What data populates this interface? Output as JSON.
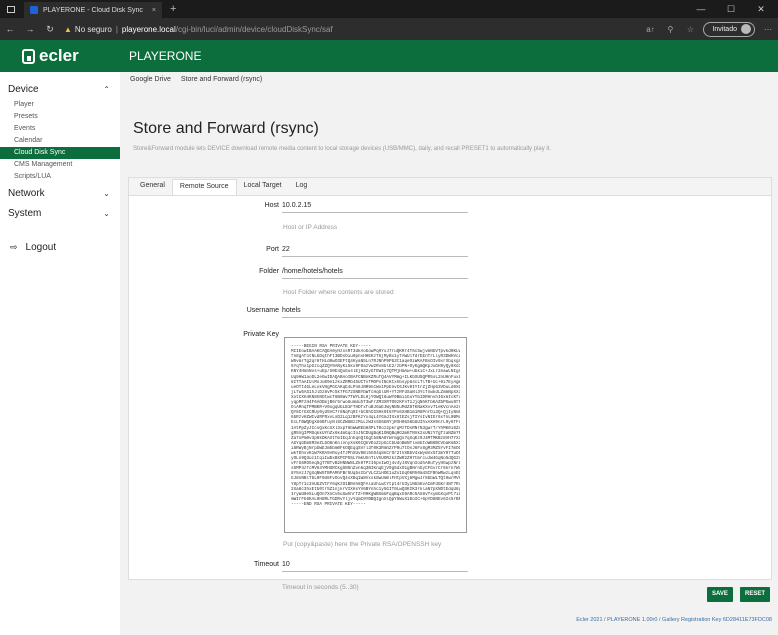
{
  "browser": {
    "tab_title": "PLAYERONE - Cloud Disk Sync",
    "tab_close": "×",
    "new_tab": "+",
    "security": "No seguro",
    "separator": "|",
    "host": "playerone.local",
    "path": "/cgi-bin/luci/admin/device/cloudDiskSync/saf",
    "profile_label": "Invitado",
    "icons": [
      "back-icon",
      "forward-icon",
      "reload-icon",
      "warning-icon",
      "read-aloud-icon",
      "zoom-icon",
      "favorites-icon",
      "more-icon"
    ]
  },
  "header": {
    "logo_text": "ecler",
    "brand": "PLAYERONE",
    "color": "#0b6e3c"
  },
  "sidebar": {
    "sections": [
      {
        "label": "Device",
        "expanded": true,
        "items": [
          "Player",
          "Presets",
          "Events",
          "Calendar",
          "Cloud Disk Sync",
          "CMS Management",
          "Scripts/LUA"
        ],
        "active": "Cloud Disk Sync"
      },
      {
        "label": "Network",
        "expanded": false
      },
      {
        "label": "System",
        "expanded": false
      }
    ],
    "logout": "Logout"
  },
  "breadcrumb": [
    "Google Drive",
    "Store and Forward (rsync)"
  ],
  "page": {
    "title": "Store and Forward (rsync)",
    "description": "Store&Forward module lets DEVICE download remote media content to local storage devices (USB/MMC), daily, and recall PRESET1 to automatically play it."
  },
  "tabs": [
    "General",
    "Remote Source",
    "Local Target",
    "Log"
  ],
  "active_tab": "Remote Source",
  "form": {
    "host": {
      "label": "Host",
      "value": "10.0.2.15",
      "hint": "Host or IP Address"
    },
    "port": {
      "label": "Port",
      "value": "22"
    },
    "folder": {
      "label": "Folder",
      "value": "/home/hotels/hotels",
      "hint": "Host Folder where contents are stored"
    },
    "username": {
      "label": "Username",
      "value": "hotels"
    },
    "private_key": {
      "label": "Private Key",
      "lines": [
        "-----BEGIN RSA PRIVATE KEY-----",
        "MIIEowIBAAKCAQEA0yHzxsRf3dkAoGowPqHYxJ7ruQKRr4T6c5wjvmNbVTpvkd0KLWm+",
        "fn8gAfotNLGDqthFt3BDsOiu0pnsHHEKzT6jMyBx1yfAWUlTdrEEnTrLlyR3DWHVcaX6",
        "W5vmrTg2qrHfHLd0wO3EFtQ4HyaN5Ln7RJNhP9Pb3t1aqeOiWKAFBsOIv9xrXbqsgXel",
        "6YqThx1pGzcqZZQY0ANyKi5kx9F0azVw2Rv8blE2/zbPN+OyKgmQKpJuGH9yQy0Xd1sE",
        "KNY4HmnNvs+uEp/S0E4Qu5u4lEjHZ2yGfEWIy7QTMjHmAw+ubkiC+JxLr2eawLNIgXoX",
        "Uq9HW1aoDL2eGwIDAQABAoIBAFCNBnKZRufQ4AVYMmg+ILKbSU5QPR5sL2nUHnFuxb5T",
        "8ITTaAIUlMsJu09e1zkxZRMb45UCTvfMOPxtNcKtxhbsyp84cLTlTB+Uc+0i7EyAgmi6",
        "ueOTt4GLeLvkVHgPGCAKqE4LPn6JNR9nCWo1PpEnvC6JKv0IYtrZjZHp63VDuLd0XQs8",
        "jLfw5AS1hJlDz8vPc5k7FG72SNBYbWfcHqGlUR+YfzRFdSaNl3YcfnwkdLZmmNpXXigz",
        "XotCXH4KN8hNOtwcT6B6Wv7TWYLDLHjYOWQt8uWY9Bmi1GuYYb1DRHnvhI6xmtcKfvgj",
        "yqpMFzH4F6AOEmjB6r5rwoUumUuhT3wFrZM3XRTO0zKFnT1JjqNhKfbKAZbPGwu9f5I9",
        "OlAMnqTPMBKR+V0xgqUbLB1FTHDfxfuBJ6aEJWyNN5uMdZ8TKNaKXvv71eKVcnAe2nYr",
        "QY8CrGXCRUy0yd5VC7r8NqFq0t+bC8hCGSHk0I6YPx6XHB1m1R8PnrDi3Q+QjIyNm9Mn",
        "6bRzvHZWIvdRFRxvLxD2Lq1zBFKzYx4qL4YGmJIXx6tEZsjTIYsIvNIEr6xfnL0BMoEW",
        "EcLfBWQDgXU6BfuyNl8CZWUBzzMiLzW3sSS6bNYjRXH0bS6bUUIhxAXH9nrL9y6fFr3d",
        "1AtPpZyJIcsQxKcXXl3xpf6bWwREbHSPLT0oz2pkrqMzTDsRNrN3gwrT/YhMK0i6ZcJM",
        "gR5VgIPMSqkkUYhZx6k4mGqcInJ5CDUgBqK1ONQBq0G2mKTNVk2xUNzY7gTzaNZm7RAp",
        "Za7sPm0v3pHkDKAXtfmIEqJnhqnQtGgtb8NA8YWrmgQs7qXqKz9J4MTMKBz8VH7YXaTw",
        "AGYqGEm8RSeZLbO6nKnlvnyXsK6CQkVEoZzpGcCbUdoBmNTlvmbtoWB6BCVbaKm5X3Mg",
        "i8RWyBjNrpGWEJm5bm0FkOQEqqSVrl3f0K3RmhZrP9u7tOsJ6Fx8gM3MZ5YvFI7mOOIj",
        "wkfDhxvK1W7KRA9vRuy4TJPhSUv0Bl5hD4q8kCrOr2tVXBbV4xWymVx5T2mY97TuD5s7",
        "yOLn9Q3uc1tqiIwDxBXPCP55LYmkUhnTLVhUORzkzZWR2Z97tmrcuJW4GqNo5dQG2VVP",
        "vFrG6RO5eq5gT7BTvB2HNNW8LZk0fPzI6pvIwOj4v4yJ8VqnIodhA0ufyyHGwpzNrL6k",
        "s5MP4zfcMV64YMHSRCkgSN5nZvn6q3BIKnqEjV9g5dxO1gBNrnGyCFGvrCr6krn7WVsz",
        "8Y5AzJ7gXqNW5TBPAMhFBr5UqbsIbrVLCZiHOE1uZv1bqO6Rh0m4SCFBhWRwzLqnEQq0",
        "GJ8nNBlTbL0F0d8FvOovQ4sXBq1W8Vxsk8wUm0lFHtpVXj6MgwJr8bbWiTQtHwrMVHh5",
        "Y8pTr1c3nUbZVtFY6qKzO1BReh8QFAlaUhiwtYtpt4rU3yiNbbKvAImFdGKr4Nf7Rx0V",
        "2Xa8c3hxEtb0tr5Z1njkrVIXHsYV6BYnhc1y5GIT0LwQSKIK3rklaN7pXNDtEdqU8gWB",
        "IryWd0e5LuQOn7XnCv5uSwhhrfZ+R9KgWBXmUFqqBqxG9ARc5AX8vTsymbXqvPt7iS8a",
        "mWIrFb6KAL0H8RLTGDRvYljvYqmC0YBBQIgnXlQpY5WuX1DoIC+6pYD8NEv6Is5rBNNT",
        "-----END RSA PRIVATE KEY-----"
      ],
      "hint": "Put (copy&paste) here the Private RSA/OPENSSH key"
    },
    "timeout": {
      "label": "Timeout",
      "value": "10",
      "hint": "Timeout in seconds (5..30)"
    }
  },
  "buttons": {
    "save": "SAVE",
    "reset": "RESET"
  },
  "footer": "Ecler 2021 / PLAYERONE 1.00r0 / Gallery Registration Key 6D28411E73FDC08"
}
